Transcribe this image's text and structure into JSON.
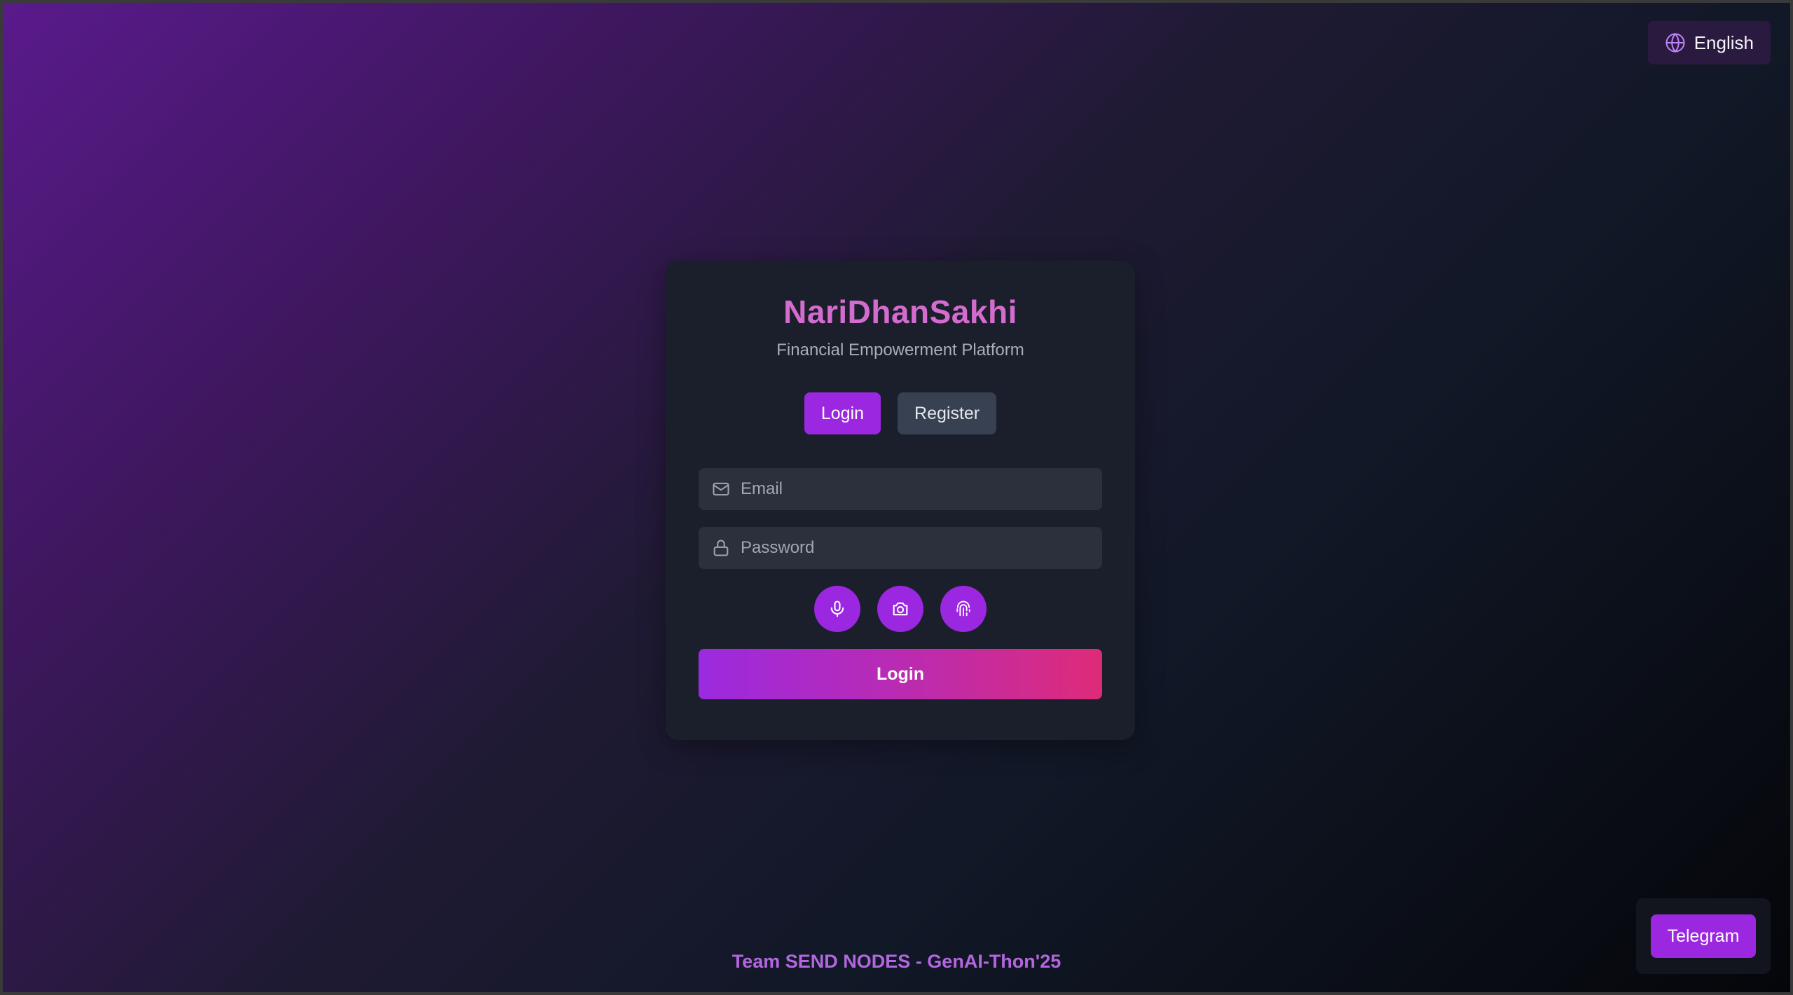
{
  "language_selector": {
    "label": "English",
    "icon": "globe-icon"
  },
  "app": {
    "title": "NariDhanSakhi",
    "subtitle": "Financial Empowerment Platform"
  },
  "tabs": [
    {
      "label": "Login",
      "active": true
    },
    {
      "label": "Register",
      "active": false
    }
  ],
  "form": {
    "email": {
      "placeholder": "Email",
      "value": "",
      "icon": "mail-icon"
    },
    "password": {
      "placeholder": "Password",
      "value": "",
      "icon": "lock-icon"
    },
    "biometric_buttons": [
      "microphone-icon",
      "camera-icon",
      "fingerprint-icon"
    ],
    "submit_label": "Login"
  },
  "footer": {
    "text": "Team SEND NODES - GenAI-Thon'25"
  },
  "telegram": {
    "label": "Telegram"
  },
  "colors": {
    "accent": "#9b27e0",
    "title": "#d46ccf",
    "gradient_end": "#de2b78"
  }
}
